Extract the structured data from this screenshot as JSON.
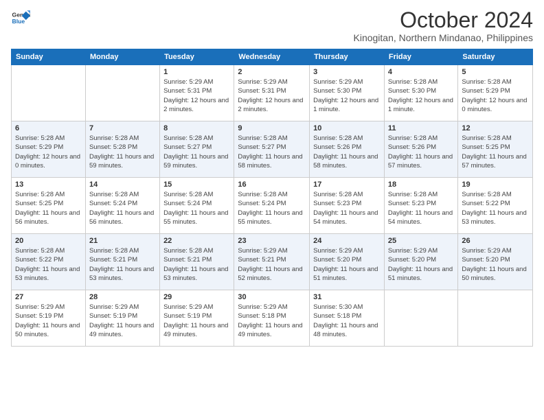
{
  "logo": {
    "line1": "General",
    "line2": "Blue"
  },
  "title": "October 2024",
  "subtitle": "Kinogitan, Northern Mindanao, Philippines",
  "days_of_week": [
    "Sunday",
    "Monday",
    "Tuesday",
    "Wednesday",
    "Thursday",
    "Friday",
    "Saturday"
  ],
  "weeks": [
    [
      {
        "num": "",
        "sunrise": "",
        "sunset": "",
        "daylight": ""
      },
      {
        "num": "",
        "sunrise": "",
        "sunset": "",
        "daylight": ""
      },
      {
        "num": "1",
        "sunrise": "Sunrise: 5:29 AM",
        "sunset": "Sunset: 5:31 PM",
        "daylight": "Daylight: 12 hours and 2 minutes."
      },
      {
        "num": "2",
        "sunrise": "Sunrise: 5:29 AM",
        "sunset": "Sunset: 5:31 PM",
        "daylight": "Daylight: 12 hours and 2 minutes."
      },
      {
        "num": "3",
        "sunrise": "Sunrise: 5:29 AM",
        "sunset": "Sunset: 5:30 PM",
        "daylight": "Daylight: 12 hours and 1 minute."
      },
      {
        "num": "4",
        "sunrise": "Sunrise: 5:28 AM",
        "sunset": "Sunset: 5:30 PM",
        "daylight": "Daylight: 12 hours and 1 minute."
      },
      {
        "num": "5",
        "sunrise": "Sunrise: 5:28 AM",
        "sunset": "Sunset: 5:29 PM",
        "daylight": "Daylight: 12 hours and 0 minutes."
      }
    ],
    [
      {
        "num": "6",
        "sunrise": "Sunrise: 5:28 AM",
        "sunset": "Sunset: 5:29 PM",
        "daylight": "Daylight: 12 hours and 0 minutes."
      },
      {
        "num": "7",
        "sunrise": "Sunrise: 5:28 AM",
        "sunset": "Sunset: 5:28 PM",
        "daylight": "Daylight: 11 hours and 59 minutes."
      },
      {
        "num": "8",
        "sunrise": "Sunrise: 5:28 AM",
        "sunset": "Sunset: 5:27 PM",
        "daylight": "Daylight: 11 hours and 59 minutes."
      },
      {
        "num": "9",
        "sunrise": "Sunrise: 5:28 AM",
        "sunset": "Sunset: 5:27 PM",
        "daylight": "Daylight: 11 hours and 58 minutes."
      },
      {
        "num": "10",
        "sunrise": "Sunrise: 5:28 AM",
        "sunset": "Sunset: 5:26 PM",
        "daylight": "Daylight: 11 hours and 58 minutes."
      },
      {
        "num": "11",
        "sunrise": "Sunrise: 5:28 AM",
        "sunset": "Sunset: 5:26 PM",
        "daylight": "Daylight: 11 hours and 57 minutes."
      },
      {
        "num": "12",
        "sunrise": "Sunrise: 5:28 AM",
        "sunset": "Sunset: 5:25 PM",
        "daylight": "Daylight: 11 hours and 57 minutes."
      }
    ],
    [
      {
        "num": "13",
        "sunrise": "Sunrise: 5:28 AM",
        "sunset": "Sunset: 5:25 PM",
        "daylight": "Daylight: 11 hours and 56 minutes."
      },
      {
        "num": "14",
        "sunrise": "Sunrise: 5:28 AM",
        "sunset": "Sunset: 5:24 PM",
        "daylight": "Daylight: 11 hours and 56 minutes."
      },
      {
        "num": "15",
        "sunrise": "Sunrise: 5:28 AM",
        "sunset": "Sunset: 5:24 PM",
        "daylight": "Daylight: 11 hours and 55 minutes."
      },
      {
        "num": "16",
        "sunrise": "Sunrise: 5:28 AM",
        "sunset": "Sunset: 5:24 PM",
        "daylight": "Daylight: 11 hours and 55 minutes."
      },
      {
        "num": "17",
        "sunrise": "Sunrise: 5:28 AM",
        "sunset": "Sunset: 5:23 PM",
        "daylight": "Daylight: 11 hours and 54 minutes."
      },
      {
        "num": "18",
        "sunrise": "Sunrise: 5:28 AM",
        "sunset": "Sunset: 5:23 PM",
        "daylight": "Daylight: 11 hours and 54 minutes."
      },
      {
        "num": "19",
        "sunrise": "Sunrise: 5:28 AM",
        "sunset": "Sunset: 5:22 PM",
        "daylight": "Daylight: 11 hours and 53 minutes."
      }
    ],
    [
      {
        "num": "20",
        "sunrise": "Sunrise: 5:28 AM",
        "sunset": "Sunset: 5:22 PM",
        "daylight": "Daylight: 11 hours and 53 minutes."
      },
      {
        "num": "21",
        "sunrise": "Sunrise: 5:28 AM",
        "sunset": "Sunset: 5:21 PM",
        "daylight": "Daylight: 11 hours and 53 minutes."
      },
      {
        "num": "22",
        "sunrise": "Sunrise: 5:28 AM",
        "sunset": "Sunset: 5:21 PM",
        "daylight": "Daylight: 11 hours and 53 minutes."
      },
      {
        "num": "23",
        "sunrise": "Sunrise: 5:29 AM",
        "sunset": "Sunset: 5:21 PM",
        "daylight": "Daylight: 11 hours and 52 minutes."
      },
      {
        "num": "24",
        "sunrise": "Sunrise: 5:29 AM",
        "sunset": "Sunset: 5:20 PM",
        "daylight": "Daylight: 11 hours and 51 minutes."
      },
      {
        "num": "25",
        "sunrise": "Sunrise: 5:29 AM",
        "sunset": "Sunset: 5:20 PM",
        "daylight": "Daylight: 11 hours and 51 minutes."
      },
      {
        "num": "26",
        "sunrise": "Sunrise: 5:29 AM",
        "sunset": "Sunset: 5:20 PM",
        "daylight": "Daylight: 11 hours and 50 minutes."
      }
    ],
    [
      {
        "num": "27",
        "sunrise": "Sunrise: 5:29 AM",
        "sunset": "Sunset: 5:19 PM",
        "daylight": "Daylight: 11 hours and 50 minutes."
      },
      {
        "num": "28",
        "sunrise": "Sunrise: 5:29 AM",
        "sunset": "Sunset: 5:19 PM",
        "daylight": "Daylight: 11 hours and 49 minutes."
      },
      {
        "num": "29",
        "sunrise": "Sunrise: 5:29 AM",
        "sunset": "Sunset: 5:19 PM",
        "daylight": "Daylight: 11 hours and 49 minutes."
      },
      {
        "num": "30",
        "sunrise": "Sunrise: 5:29 AM",
        "sunset": "Sunset: 5:18 PM",
        "daylight": "Daylight: 11 hours and 49 minutes."
      },
      {
        "num": "31",
        "sunrise": "Sunrise: 5:30 AM",
        "sunset": "Sunset: 5:18 PM",
        "daylight": "Daylight: 11 hours and 48 minutes."
      },
      {
        "num": "",
        "sunrise": "",
        "sunset": "",
        "daylight": ""
      },
      {
        "num": "",
        "sunrise": "",
        "sunset": "",
        "daylight": ""
      }
    ]
  ]
}
